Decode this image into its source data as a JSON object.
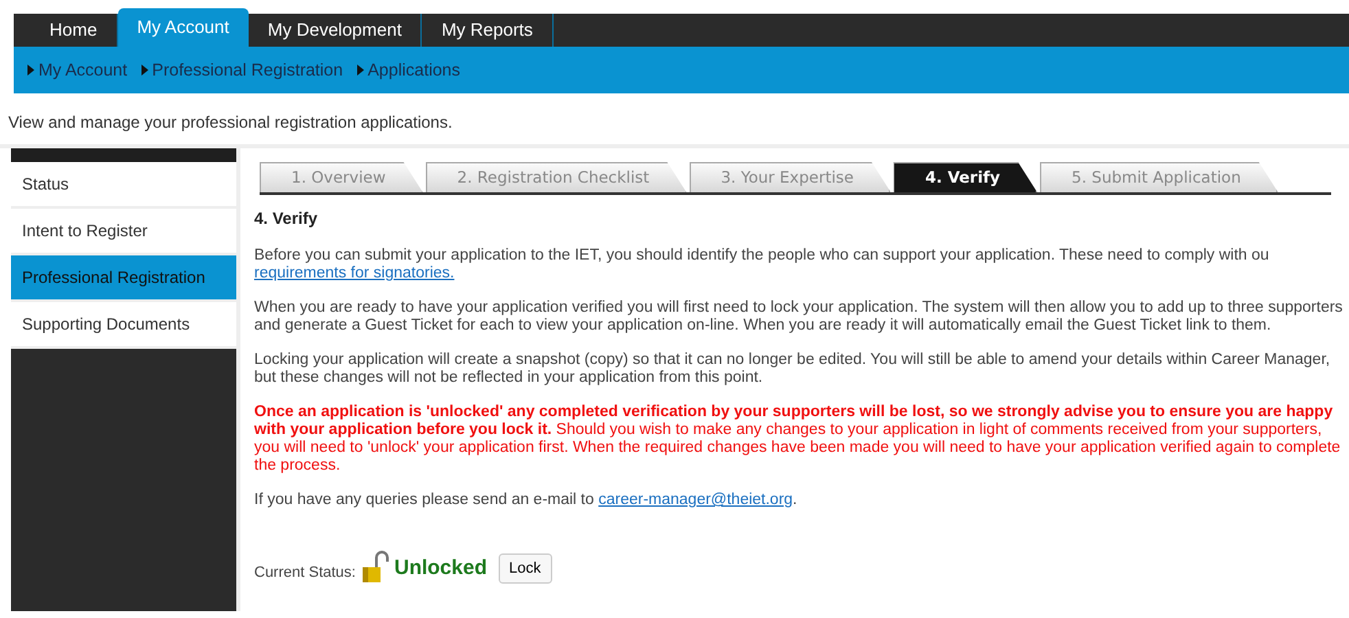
{
  "top_nav": [
    {
      "label": "Home",
      "selected": false
    },
    {
      "label": "My Account",
      "selected": true
    },
    {
      "label": "My Development",
      "selected": false
    },
    {
      "label": "My Reports",
      "selected": false
    }
  ],
  "breadcrumb": [
    "My Account",
    "Professional Registration",
    "Applications"
  ],
  "description": "View and manage your professional registration applications.",
  "sidebar": {
    "items": [
      {
        "label": "Status",
        "selected": false
      },
      {
        "label": "Intent to Register",
        "selected": false
      },
      {
        "label": "Professional Registration",
        "selected": true
      },
      {
        "label": "Supporting Documents",
        "selected": false
      }
    ]
  },
  "steps": [
    {
      "label": "1. Overview",
      "selected": false
    },
    {
      "label": "2. Registration Checklist",
      "selected": false
    },
    {
      "label": "3. Your Expertise",
      "selected": false
    },
    {
      "label": "4. Verify",
      "selected": true
    },
    {
      "label": "5. Submit Application",
      "selected": false
    }
  ],
  "heading": "4. Verify",
  "paragraphs": [
    {
      "kind": "text_link",
      "text": "Before you can submit your application to the IET, you should identify the people who can support your application. These need to comply with ou",
      "link": "requirements for signatories."
    },
    {
      "kind": "text",
      "text": "When you are ready to have your application verified you will first need to lock your application. The system will then allow you to add up to three supporters and generate a Guest Ticket for each to view your application on-line. When you are ready it will automatically email the Guest Ticket link to them."
    },
    {
      "kind": "text",
      "text": "Locking your application will create a snapshot (copy) so that it can no longer be edited. You will still be able to amend your details within Career Manager, but these changes will not be reflected in your application from this point."
    },
    {
      "kind": "warning",
      "text": "**Once an application is 'unlocked' any completed verification by your supporters will be lost, so we strongly advise you to ensure you are happy with your application before you lock it.** Should you wish to make any changes to your application in light of comments received from your supporters, you will need to 'unlock' your application first. When the required changes have been made you will need to have your application verified again to complete the process."
    },
    {
      "kind": "email",
      "text": "If you have any queries please send an e-mail to ",
      "link": "career-manager@theiet.org",
      "after": "."
    }
  ],
  "status": {
    "label": "Current Status:",
    "locked": false,
    "value": "Unlocked",
    "button": "Lock"
  }
}
